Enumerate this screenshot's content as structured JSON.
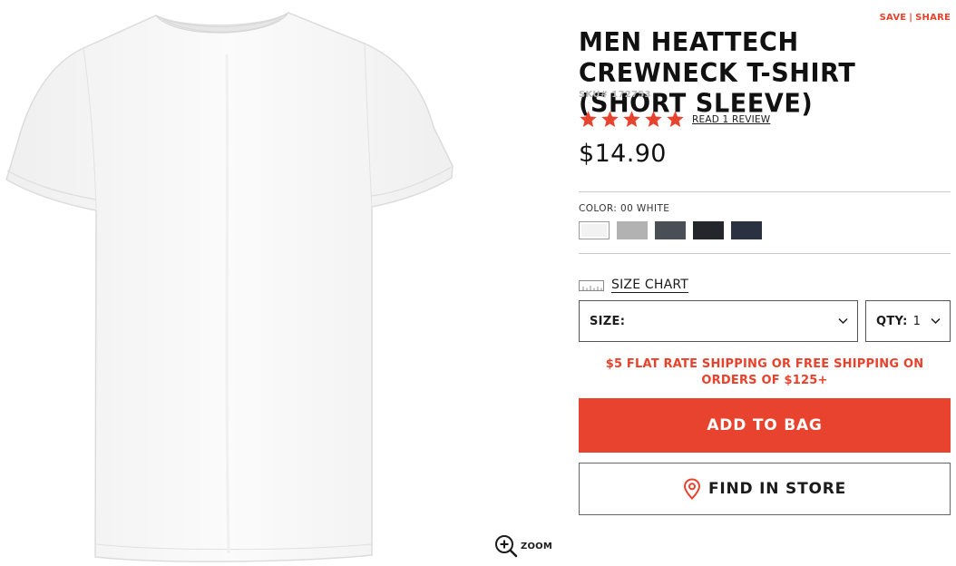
{
  "product": {
    "title": "MEN HEATTECH CREWNECK T-SHIRT (SHORT SLEEVE)",
    "sku": "SKU# 172753",
    "price": "$14.90",
    "rating_stars": 5,
    "review_link": "READ 1 REVIEW",
    "image_alt": "white crew neck short sleeve t-shirt"
  },
  "actions": {
    "save": "SAVE",
    "separator": "|",
    "share": "SHARE"
  },
  "color": {
    "label": "COLOR:",
    "selected": "00 WHITE",
    "swatches": [
      {
        "name": "white",
        "hex": "#f2f2f2",
        "selected": true
      },
      {
        "name": "light-gray",
        "hex": "#b2b2b2",
        "selected": false
      },
      {
        "name": "dark-gray",
        "hex": "#4a4f55",
        "selected": false
      },
      {
        "name": "black",
        "hex": "#23272b",
        "selected": false
      },
      {
        "name": "navy",
        "hex": "#2a3140",
        "selected": false
      }
    ]
  },
  "size_chart": {
    "label": "SIZE CHART",
    "icon": "ruler-icon"
  },
  "size_select": {
    "label": "SIZE:",
    "value": ""
  },
  "qty_select": {
    "label": "QTY:",
    "value": "1"
  },
  "shipping_notice": "$5 FLAT RATE SHIPPING OR FREE SHIPPING ON ORDERS OF $125+",
  "buttons": {
    "add_to_bag": "ADD TO BAG",
    "find_in_store": "FIND IN STORE"
  },
  "zoom": {
    "label": "ZOOM",
    "icon": "zoom-in-icon"
  },
  "colors": {
    "accent": "#e8432e",
    "text": "#1b1b1b",
    "muted": "#b8b8b8"
  }
}
